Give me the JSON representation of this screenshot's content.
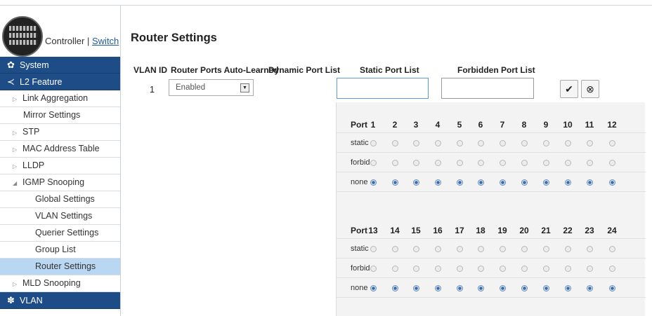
{
  "brand": {
    "controller_label": "Controller",
    "separator": "|",
    "switch_label": "Switch"
  },
  "sidebar": {
    "items": [
      {
        "label": "System",
        "kind": "head",
        "icon": "gear-icon"
      },
      {
        "label": "L2 Feature",
        "kind": "head",
        "icon": "share-icon"
      },
      {
        "label": "Link Aggregation",
        "kind": "collapsed"
      },
      {
        "label": "Mirror Settings",
        "kind": "plain"
      },
      {
        "label": "STP",
        "kind": "collapsed"
      },
      {
        "label": "MAC Address Table",
        "kind": "collapsed"
      },
      {
        "label": "LLDP",
        "kind": "collapsed"
      },
      {
        "label": "IGMP Snooping",
        "kind": "expanded"
      },
      {
        "label": "Global Settings",
        "kind": "sub"
      },
      {
        "label": "VLAN Settings",
        "kind": "sub"
      },
      {
        "label": "Querier Settings",
        "kind": "sub"
      },
      {
        "label": "Group List",
        "kind": "sub"
      },
      {
        "label": "Router Settings",
        "kind": "sub-active"
      },
      {
        "label": "MLD Snooping",
        "kind": "collapsed"
      },
      {
        "label": "VLAN",
        "kind": "head",
        "icon": "cluster-icon"
      }
    ]
  },
  "page": {
    "title": "Router Settings"
  },
  "table": {
    "headers": {
      "vlan_id": "VLAN ID",
      "auto_learned": "Router Ports Auto-Learned",
      "dynamic": "Dynamic Port List",
      "static": "Static Port List",
      "forbidden": "Forbidden Port List"
    },
    "row": {
      "vlan_id": "1",
      "auto_learned": "Enabled",
      "static_value": "",
      "forbidden_value": ""
    },
    "apply_icon": "checkmark-icon",
    "clear_icon": "close-circle-icon"
  },
  "port_popup": {
    "port_label": "Port",
    "row_labels": [
      "static",
      "forbid",
      "none"
    ],
    "groups": [
      {
        "ports": [
          "1",
          "2",
          "3",
          "4",
          "5",
          "6",
          "7",
          "8",
          "9",
          "10",
          "11",
          "12"
        ],
        "selected": "none"
      },
      {
        "ports": [
          "13",
          "14",
          "15",
          "16",
          "17",
          "18",
          "19",
          "20",
          "21",
          "22",
          "23",
          "24"
        ],
        "selected": "none"
      }
    ]
  },
  "colors": {
    "nav_head": "#1e4c87",
    "nav_active": "#b9d7f2",
    "link": "#1e5a9c",
    "focus_border": "#5b9bd5"
  }
}
